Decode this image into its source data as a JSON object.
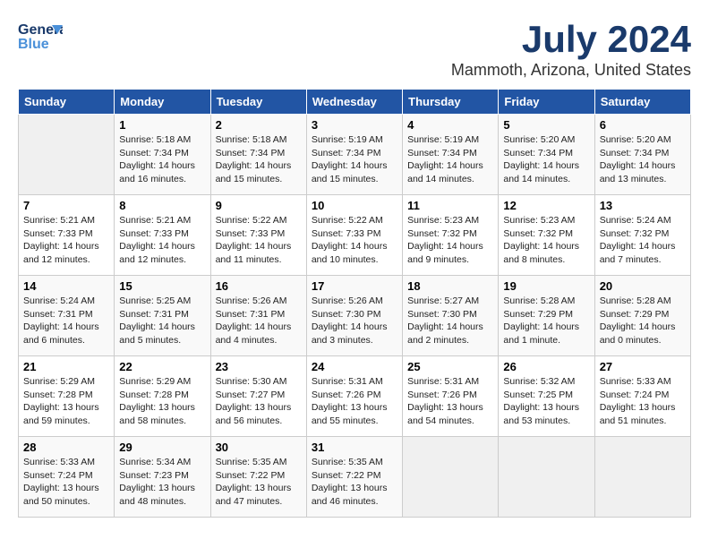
{
  "header": {
    "logo_general": "General",
    "logo_blue": "Blue",
    "title": "July 2024",
    "subtitle": "Mammoth, Arizona, United States"
  },
  "days_of_week": [
    "Sunday",
    "Monday",
    "Tuesday",
    "Wednesday",
    "Thursday",
    "Friday",
    "Saturday"
  ],
  "weeks": [
    [
      {
        "day": "",
        "text": ""
      },
      {
        "day": "1",
        "text": "Sunrise: 5:18 AM\nSunset: 7:34 PM\nDaylight: 14 hours\nand 16 minutes."
      },
      {
        "day": "2",
        "text": "Sunrise: 5:18 AM\nSunset: 7:34 PM\nDaylight: 14 hours\nand 15 minutes."
      },
      {
        "day": "3",
        "text": "Sunrise: 5:19 AM\nSunset: 7:34 PM\nDaylight: 14 hours\nand 15 minutes."
      },
      {
        "day": "4",
        "text": "Sunrise: 5:19 AM\nSunset: 7:34 PM\nDaylight: 14 hours\nand 14 minutes."
      },
      {
        "day": "5",
        "text": "Sunrise: 5:20 AM\nSunset: 7:34 PM\nDaylight: 14 hours\nand 14 minutes."
      },
      {
        "day": "6",
        "text": "Sunrise: 5:20 AM\nSunset: 7:34 PM\nDaylight: 14 hours\nand 13 minutes."
      }
    ],
    [
      {
        "day": "7",
        "text": "Sunrise: 5:21 AM\nSunset: 7:33 PM\nDaylight: 14 hours\nand 12 minutes."
      },
      {
        "day": "8",
        "text": "Sunrise: 5:21 AM\nSunset: 7:33 PM\nDaylight: 14 hours\nand 12 minutes."
      },
      {
        "day": "9",
        "text": "Sunrise: 5:22 AM\nSunset: 7:33 PM\nDaylight: 14 hours\nand 11 minutes."
      },
      {
        "day": "10",
        "text": "Sunrise: 5:22 AM\nSunset: 7:33 PM\nDaylight: 14 hours\nand 10 minutes."
      },
      {
        "day": "11",
        "text": "Sunrise: 5:23 AM\nSunset: 7:32 PM\nDaylight: 14 hours\nand 9 minutes."
      },
      {
        "day": "12",
        "text": "Sunrise: 5:23 AM\nSunset: 7:32 PM\nDaylight: 14 hours\nand 8 minutes."
      },
      {
        "day": "13",
        "text": "Sunrise: 5:24 AM\nSunset: 7:32 PM\nDaylight: 14 hours\nand 7 minutes."
      }
    ],
    [
      {
        "day": "14",
        "text": "Sunrise: 5:24 AM\nSunset: 7:31 PM\nDaylight: 14 hours\nand 6 minutes."
      },
      {
        "day": "15",
        "text": "Sunrise: 5:25 AM\nSunset: 7:31 PM\nDaylight: 14 hours\nand 5 minutes."
      },
      {
        "day": "16",
        "text": "Sunrise: 5:26 AM\nSunset: 7:31 PM\nDaylight: 14 hours\nand 4 minutes."
      },
      {
        "day": "17",
        "text": "Sunrise: 5:26 AM\nSunset: 7:30 PM\nDaylight: 14 hours\nand 3 minutes."
      },
      {
        "day": "18",
        "text": "Sunrise: 5:27 AM\nSunset: 7:30 PM\nDaylight: 14 hours\nand 2 minutes."
      },
      {
        "day": "19",
        "text": "Sunrise: 5:28 AM\nSunset: 7:29 PM\nDaylight: 14 hours\nand 1 minute."
      },
      {
        "day": "20",
        "text": "Sunrise: 5:28 AM\nSunset: 7:29 PM\nDaylight: 14 hours\nand 0 minutes."
      }
    ],
    [
      {
        "day": "21",
        "text": "Sunrise: 5:29 AM\nSunset: 7:28 PM\nDaylight: 13 hours\nand 59 minutes."
      },
      {
        "day": "22",
        "text": "Sunrise: 5:29 AM\nSunset: 7:28 PM\nDaylight: 13 hours\nand 58 minutes."
      },
      {
        "day": "23",
        "text": "Sunrise: 5:30 AM\nSunset: 7:27 PM\nDaylight: 13 hours\nand 56 minutes."
      },
      {
        "day": "24",
        "text": "Sunrise: 5:31 AM\nSunset: 7:26 PM\nDaylight: 13 hours\nand 55 minutes."
      },
      {
        "day": "25",
        "text": "Sunrise: 5:31 AM\nSunset: 7:26 PM\nDaylight: 13 hours\nand 54 minutes."
      },
      {
        "day": "26",
        "text": "Sunrise: 5:32 AM\nSunset: 7:25 PM\nDaylight: 13 hours\nand 53 minutes."
      },
      {
        "day": "27",
        "text": "Sunrise: 5:33 AM\nSunset: 7:24 PM\nDaylight: 13 hours\nand 51 minutes."
      }
    ],
    [
      {
        "day": "28",
        "text": "Sunrise: 5:33 AM\nSunset: 7:24 PM\nDaylight: 13 hours\nand 50 minutes."
      },
      {
        "day": "29",
        "text": "Sunrise: 5:34 AM\nSunset: 7:23 PM\nDaylight: 13 hours\nand 48 minutes."
      },
      {
        "day": "30",
        "text": "Sunrise: 5:35 AM\nSunset: 7:22 PM\nDaylight: 13 hours\nand 47 minutes."
      },
      {
        "day": "31",
        "text": "Sunrise: 5:35 AM\nSunset: 7:22 PM\nDaylight: 13 hours\nand 46 minutes."
      },
      {
        "day": "",
        "text": ""
      },
      {
        "day": "",
        "text": ""
      },
      {
        "day": "",
        "text": ""
      }
    ]
  ]
}
